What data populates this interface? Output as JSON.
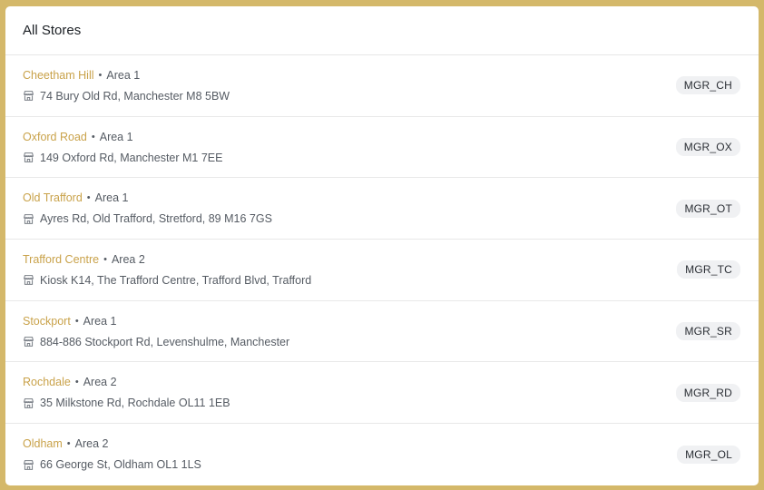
{
  "header": {
    "title": "All Stores"
  },
  "separator": "•",
  "stores": [
    {
      "name": "Cheetham Hill",
      "area": "Area 1",
      "address": "74 Bury Old Rd, Manchester M8 5BW",
      "code": "MGR_CH"
    },
    {
      "name": "Oxford Road",
      "area": "Area 1",
      "address": "149 Oxford Rd, Manchester M1 7EE",
      "code": "MGR_OX"
    },
    {
      "name": "Old Trafford",
      "area": "Area 1",
      "address": "Ayres Rd, Old Trafford, Stretford, 89 M16 7GS",
      "code": "MGR_OT"
    },
    {
      "name": "Trafford Centre",
      "area": "Area 2",
      "address": "Kiosk K14, The Trafford Centre, Trafford Blvd, Trafford",
      "code": "MGR_TC"
    },
    {
      "name": "Stockport",
      "area": "Area 1",
      "address": "884-886 Stockport Rd, Levenshulme, Manchester",
      "code": "MGR_SR"
    },
    {
      "name": "Rochdale",
      "area": "Area 2",
      "address": "35 Milkstone Rd, Rochdale OL11 1EB",
      "code": "MGR_RD"
    },
    {
      "name": "Oldham",
      "area": "Area 2",
      "address": "66 George St, Oldham OL1 1LS",
      "code": "MGR_OL"
    }
  ],
  "colors": {
    "background": "#d4b86a",
    "store_name": "#c9a24a",
    "badge_bg": "#f0f1f3"
  },
  "icons": {
    "address": "storefront-icon"
  }
}
